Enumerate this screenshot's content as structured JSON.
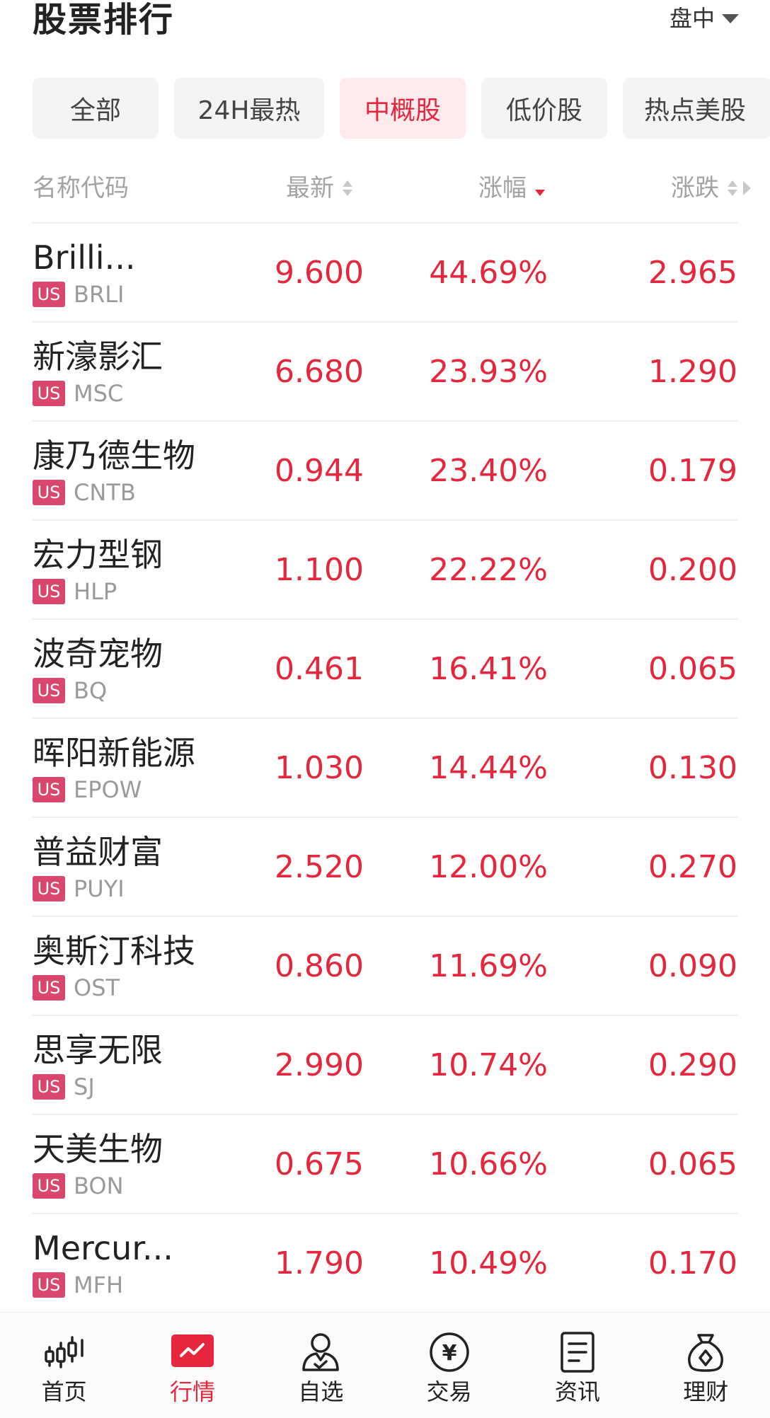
{
  "header": {
    "title": "股票排行",
    "session_label": "盘中"
  },
  "tabs": [
    {
      "label": "全部",
      "active": false
    },
    {
      "label": "24H最热",
      "active": false
    },
    {
      "label": "中概股",
      "active": true
    },
    {
      "label": "低价股",
      "active": false
    },
    {
      "label": "热点美股",
      "active": false
    }
  ],
  "columns": {
    "name": "名称代码",
    "latest": "最新",
    "change_pct": "涨幅",
    "change": "涨跌",
    "active_sort": "change_pct",
    "active_sort_direction": "desc"
  },
  "market_badge": "US",
  "rows": [
    {
      "name": "Brilli...",
      "code": "BRLI",
      "latest": "9.600",
      "pct": "44.69%",
      "chg": "2.965"
    },
    {
      "name": "新濠影汇",
      "code": "MSC",
      "latest": "6.680",
      "pct": "23.93%",
      "chg": "1.290"
    },
    {
      "name": "康乃德生物",
      "code": "CNTB",
      "latest": "0.944",
      "pct": "23.40%",
      "chg": "0.179"
    },
    {
      "name": "宏力型钢",
      "code": "HLP",
      "latest": "1.100",
      "pct": "22.22%",
      "chg": "0.200"
    },
    {
      "name": "波奇宠物",
      "code": "BQ",
      "latest": "0.461",
      "pct": "16.41%",
      "chg": "0.065"
    },
    {
      "name": "晖阳新能源",
      "code": "EPOW",
      "latest": "1.030",
      "pct": "14.44%",
      "chg": "0.130"
    },
    {
      "name": "普益财富",
      "code": "PUYI",
      "latest": "2.520",
      "pct": "12.00%",
      "chg": "0.270"
    },
    {
      "name": "奥斯汀科技",
      "code": "OST",
      "latest": "0.860",
      "pct": "11.69%",
      "chg": "0.090"
    },
    {
      "name": "思享无限",
      "code": "SJ",
      "latest": "2.990",
      "pct": "10.74%",
      "chg": "0.290"
    },
    {
      "name": "天美生物",
      "code": "BON",
      "latest": "0.675",
      "pct": "10.66%",
      "chg": "0.065"
    },
    {
      "name": "Mercur...",
      "code": "MFH",
      "latest": "1.790",
      "pct": "10.49%",
      "chg": "0.170"
    }
  ],
  "bottom_nav": [
    {
      "label": "首页",
      "icon": "candlestick-chart-icon",
      "active": false
    },
    {
      "label": "行情",
      "icon": "market-trend-icon",
      "active": true
    },
    {
      "label": "自选",
      "icon": "watchlist-person-icon",
      "active": false
    },
    {
      "label": "交易",
      "icon": "yuan-coin-icon",
      "active": false
    },
    {
      "label": "资讯",
      "icon": "news-document-icon",
      "active": false
    },
    {
      "label": "理财",
      "icon": "money-bag-icon",
      "active": false
    }
  ],
  "colors": {
    "accent_red": "#e5263d",
    "badge_pink": "#d9476f",
    "tab_active_bg": "#fdeaec",
    "tab_bg": "#f4f4f4"
  }
}
